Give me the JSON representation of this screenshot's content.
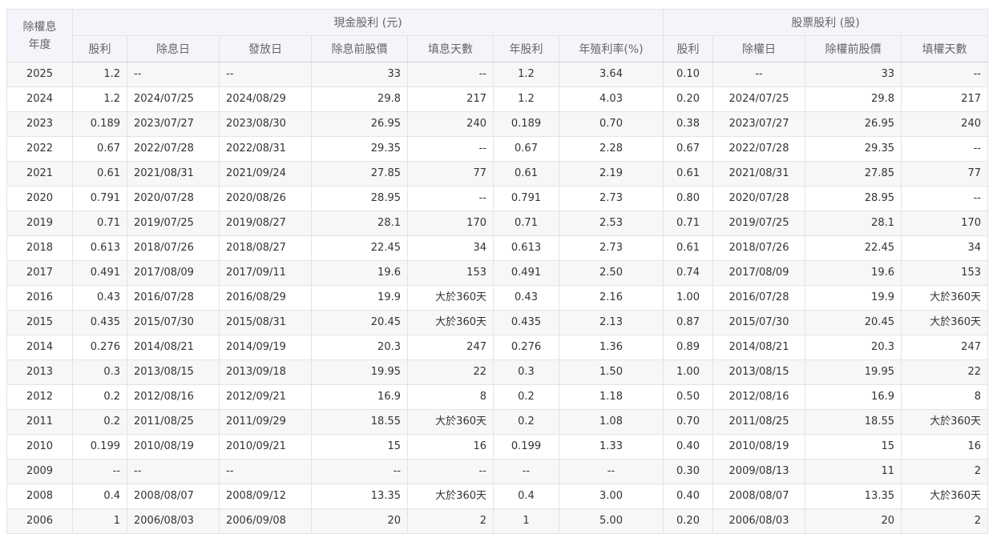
{
  "table": {
    "group_headers": {
      "year_label": "除權息年度",
      "cash": "現金股利 (元)",
      "stock": "股票股利 (股)"
    },
    "columns": [
      "股利",
      "除息日",
      "發放日",
      "除息前股價",
      "填息天數",
      "年股利",
      "年殖利率(%)",
      "股利",
      "除權日",
      "除權前股價",
      "填權天數"
    ],
    "rows": [
      [
        "2025",
        "1.2",
        "--",
        "--",
        "33",
        "--",
        "1.2",
        "3.64",
        "0.10",
        "--",
        "33",
        "--"
      ],
      [
        "2024",
        "1.2",
        "2024/07/25",
        "2024/08/29",
        "29.8",
        "217",
        "1.2",
        "4.03",
        "0.20",
        "2024/07/25",
        "29.8",
        "217"
      ],
      [
        "2023",
        "0.189",
        "2023/07/27",
        "2023/08/30",
        "26.95",
        "240",
        "0.189",
        "0.70",
        "0.38",
        "2023/07/27",
        "26.95",
        "240"
      ],
      [
        "2022",
        "0.67",
        "2022/07/28",
        "2022/08/31",
        "29.35",
        "--",
        "0.67",
        "2.28",
        "0.67",
        "2022/07/28",
        "29.35",
        "--"
      ],
      [
        "2021",
        "0.61",
        "2021/08/31",
        "2021/09/24",
        "27.85",
        "77",
        "0.61",
        "2.19",
        "0.61",
        "2021/08/31",
        "27.85",
        "77"
      ],
      [
        "2020",
        "0.791",
        "2020/07/28",
        "2020/08/26",
        "28.95",
        "--",
        "0.791",
        "2.73",
        "0.80",
        "2020/07/28",
        "28.95",
        "--"
      ],
      [
        "2019",
        "0.71",
        "2019/07/25",
        "2019/08/27",
        "28.1",
        "170",
        "0.71",
        "2.53",
        "0.71",
        "2019/07/25",
        "28.1",
        "170"
      ],
      [
        "2018",
        "0.613",
        "2018/07/26",
        "2018/08/27",
        "22.45",
        "34",
        "0.613",
        "2.73",
        "0.61",
        "2018/07/26",
        "22.45",
        "34"
      ],
      [
        "2017",
        "0.491",
        "2017/08/09",
        "2017/09/11",
        "19.6",
        "153",
        "0.491",
        "2.50",
        "0.74",
        "2017/08/09",
        "19.6",
        "153"
      ],
      [
        "2016",
        "0.43",
        "2016/07/28",
        "2016/08/29",
        "19.9",
        "大於360天",
        "0.43",
        "2.16",
        "1.00",
        "2016/07/28",
        "19.9",
        "大於360天"
      ],
      [
        "2015",
        "0.435",
        "2015/07/30",
        "2015/08/31",
        "20.45",
        "大於360天",
        "0.435",
        "2.13",
        "0.87",
        "2015/07/30",
        "20.45",
        "大於360天"
      ],
      [
        "2014",
        "0.276",
        "2014/08/21",
        "2014/09/19",
        "20.3",
        "247",
        "0.276",
        "1.36",
        "0.89",
        "2014/08/21",
        "20.3",
        "247"
      ],
      [
        "2013",
        "0.3",
        "2013/08/15",
        "2013/09/18",
        "19.95",
        "22",
        "0.3",
        "1.50",
        "1.00",
        "2013/08/15",
        "19.95",
        "22"
      ],
      [
        "2012",
        "0.2",
        "2012/08/16",
        "2012/09/21",
        "16.9",
        "8",
        "0.2",
        "1.18",
        "0.50",
        "2012/08/16",
        "16.9",
        "8"
      ],
      [
        "2011",
        "0.2",
        "2011/08/25",
        "2011/09/29",
        "18.55",
        "大於360天",
        "0.2",
        "1.08",
        "0.70",
        "2011/08/25",
        "18.55",
        "大於360天"
      ],
      [
        "2010",
        "0.199",
        "2010/08/19",
        "2010/09/21",
        "15",
        "16",
        "0.199",
        "1.33",
        "0.40",
        "2010/08/19",
        "15",
        "16"
      ],
      [
        "2009",
        "--",
        "--",
        "--",
        "--",
        "--",
        "--",
        "--",
        "0.30",
        "2009/08/13",
        "11",
        "2"
      ],
      [
        "2008",
        "0.4",
        "2008/08/07",
        "2008/09/12",
        "13.35",
        "大於360天",
        "0.4",
        "3.00",
        "0.40",
        "2008/08/07",
        "13.35",
        "大於360天"
      ],
      [
        "2006",
        "1",
        "2006/08/03",
        "2006/09/08",
        "20",
        "2",
        "1",
        "5.00",
        "0.20",
        "2006/08/03",
        "20",
        "2"
      ]
    ]
  },
  "colors": {
    "header_bg": "#f3f5fa",
    "row_alt_bg": "#f7f7f8",
    "border": "#e3e3e3",
    "text": "#333333"
  }
}
